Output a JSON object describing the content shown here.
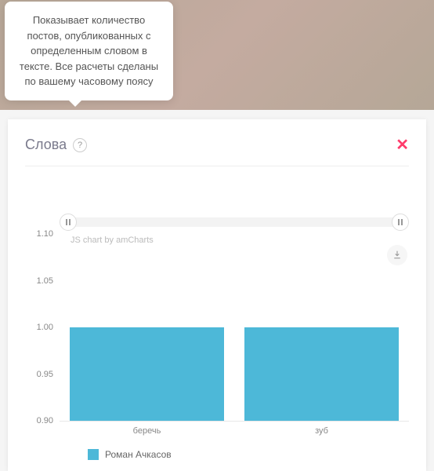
{
  "tooltip": {
    "text": "Показывает количество постов, опубликованных с определенным словом в тексте. Все расчеты сделаны по вашему часовому поясу"
  },
  "card": {
    "title": "Слова",
    "help_symbol": "?",
    "close_symbol": "✕"
  },
  "credit": "JS chart by amCharts",
  "legend": {
    "label": "Роман Ачкасов"
  },
  "chart_colors": {
    "bar": "#4db8d8"
  },
  "chart_data": {
    "type": "bar",
    "title": "Слова",
    "xlabel": "",
    "ylabel": "",
    "ylim": [
      0.9,
      1.1
    ],
    "yticks": [
      0.9,
      0.95,
      1.0,
      1.05,
      1.1
    ],
    "categories": [
      "беречь",
      "зуб"
    ],
    "series": [
      {
        "name": "Роман Ачкасов",
        "values": [
          1.0,
          1.0
        ]
      }
    ]
  }
}
